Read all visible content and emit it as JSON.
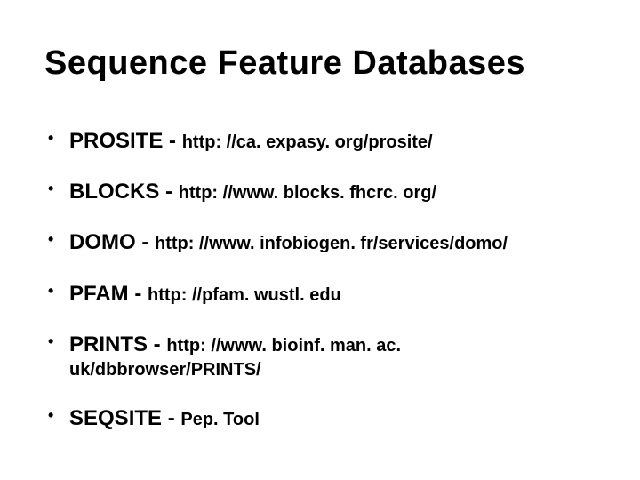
{
  "title": "Sequence Feature Databases",
  "items": [
    {
      "name": "PROSITE",
      "sep": " - ",
      "url": "http: //ca. expasy. org/prosite/"
    },
    {
      "name": "BLOCKS",
      "sep": " - ",
      "url": "http: //www. blocks. fhcrc. org/"
    },
    {
      "name": "DOMO",
      "sep": " - ",
      "url": "http: //www. infobiogen. fr/services/domo/"
    },
    {
      "name": "PFAM",
      "sep": " - ",
      "url": "http: //pfam. wustl. edu"
    },
    {
      "name": "PRINTS",
      "sep": " - ",
      "url": "http: //www. bioinf. man. ac. uk/dbbrowser/PRINTS/"
    },
    {
      "name": "SEQSITE",
      "sep": " - ",
      "url": "Pep. Tool"
    }
  ]
}
